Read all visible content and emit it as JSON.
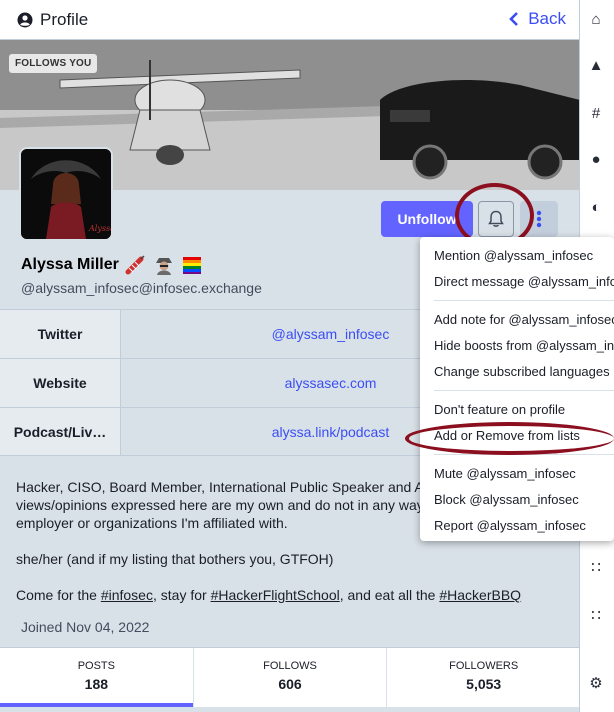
{
  "topbar": {
    "title": "Profile",
    "back_label": "Back"
  },
  "header": {
    "follows_badge": "FOLLOWS YOU"
  },
  "actions": {
    "unfollow_label": "Unfollow"
  },
  "profile": {
    "display_name": "Alyssa Miller",
    "handle": "@alyssam_infosec@infosec.exchange"
  },
  "fields": [
    {
      "name": "Twitter",
      "value": "@alyssam_infosec"
    },
    {
      "name": "Website",
      "value": "alyssasec.com"
    },
    {
      "name": "Podcast/Liv…",
      "value": "alyssa.link/podcast"
    }
  ],
  "bio": {
    "p1": "Hacker, CISO, Board Member, International Public Speaker and Au\nviews/opinions expressed here are my own and do not in any way\nemployer or organizations I'm affiliated with.",
    "p2": "she/her (and if my listing that bothers you, GTFOH)",
    "p3_a": "Come for the ",
    "p3_tag1": "#infosec",
    "p3_b": ", stay for ",
    "p3_tag2": "#HackerFlightSchool",
    "p3_c": ", and eat all the ",
    "p3_tag3": "#HackerBBQ"
  },
  "joined": "Joined Nov 04, 2022",
  "stats": [
    {
      "label": "POSTS",
      "value": "188"
    },
    {
      "label": "FOLLOWS",
      "value": "606"
    },
    {
      "label": "FOLLOWERS",
      "value": "5,053"
    }
  ],
  "menu": {
    "mention": "Mention @alyssam_infosec",
    "direct_message": "Direct message @alyssam_info",
    "add_note": "Add note for @alyssam_infosec",
    "hide_boosts": "Hide boosts from @alyssam_in",
    "change_languages": "Change subscribed languages",
    "dont_feature": "Don't feature on profile",
    "add_remove_lists": "Add or Remove from lists",
    "mute": "Mute @alyssam_infosec",
    "block": "Block @alyssam_infosec",
    "report": "Report @alyssam_infosec"
  },
  "colors": {
    "accent": "#6364ff",
    "link": "#3a4df5",
    "annotation": "#8b0f1f"
  }
}
